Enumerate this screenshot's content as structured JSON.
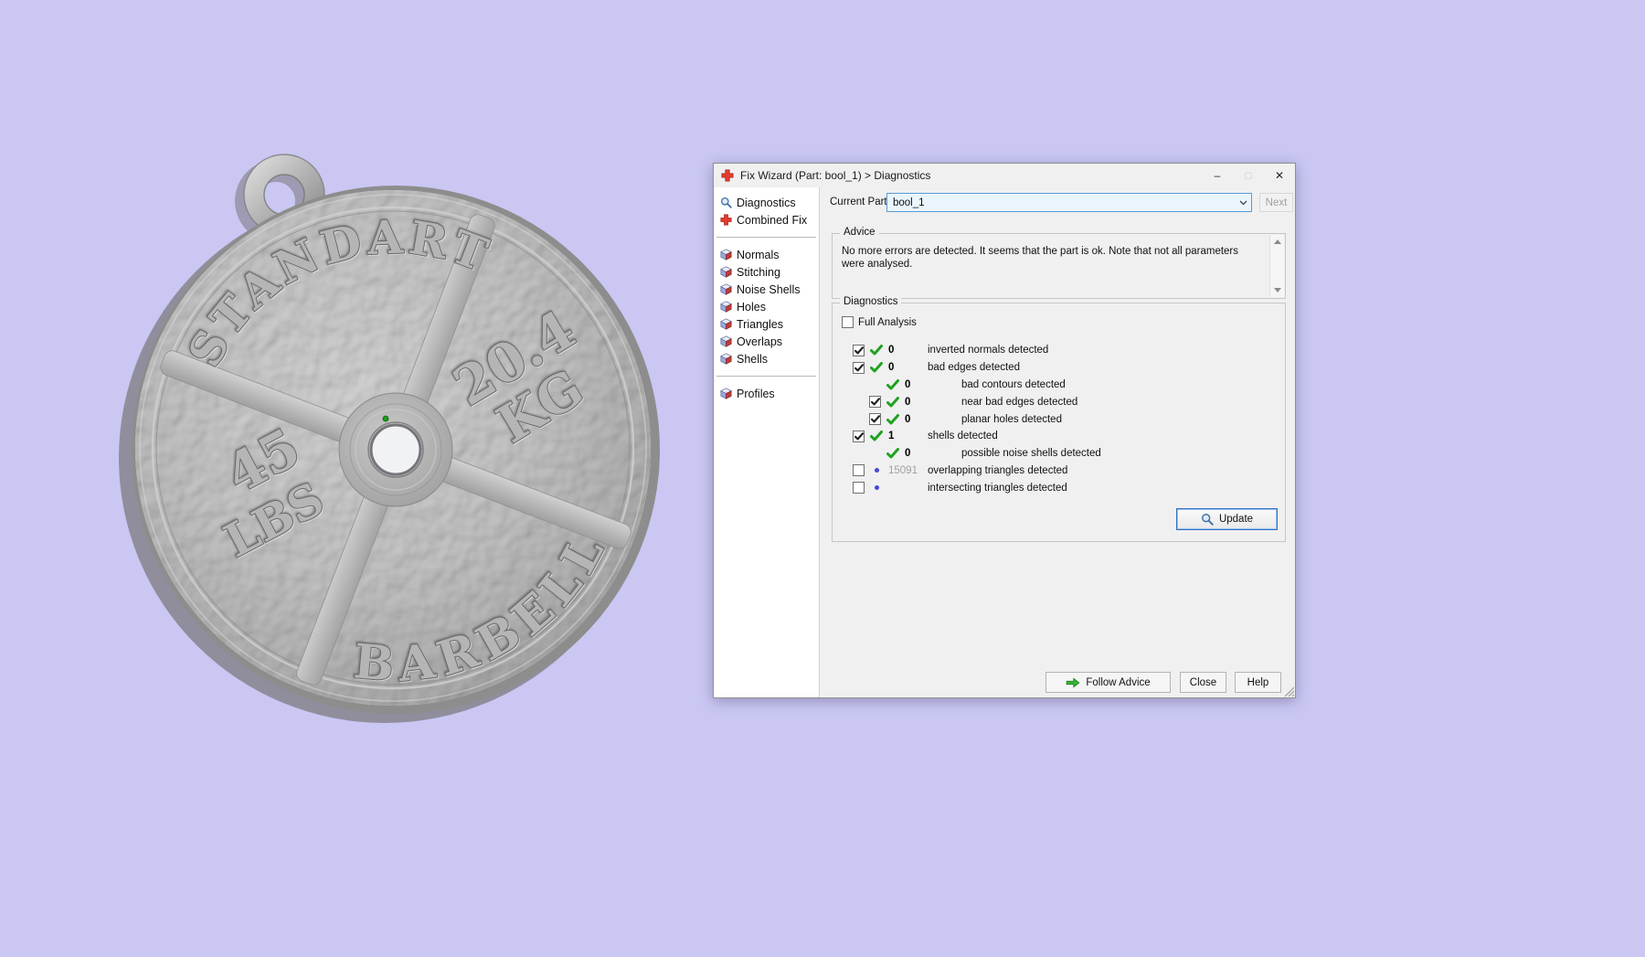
{
  "colors": {
    "page_background": "#cac7f3",
    "check_green": "#1ea21e",
    "marker_blue": "#4646d8",
    "combo_border": "#5a9bd5",
    "update_border": "#2f6fc1",
    "title_icon_red": "#e23b2e"
  },
  "scene": {
    "plate": {
      "arc_top": "STANDART",
      "arc_bottom": "BARBELL",
      "kg_value": "20.4",
      "kg_unit": "KG",
      "lbs_value": "45",
      "lbs_unit": "LBS"
    }
  },
  "window": {
    "title": "Fix Wizard (Part: bool_1) > Diagnostics",
    "controls": {
      "minimize": "–",
      "maximize": "□",
      "close": "✕"
    },
    "sidebar": {
      "items": [
        {
          "label": "Diagnostics"
        },
        {
          "label": "Combined Fix"
        },
        {
          "label": "Normals"
        },
        {
          "label": "Stitching"
        },
        {
          "label": "Noise Shells"
        },
        {
          "label": "Holes"
        },
        {
          "label": "Triangles"
        },
        {
          "label": "Overlaps"
        },
        {
          "label": "Shells"
        },
        {
          "label": "Profiles"
        }
      ]
    },
    "toolbar": {
      "current_part_label": "Current Part:",
      "current_part_value": "bool_1",
      "next_label": "Next"
    },
    "advice": {
      "legend": "Advice",
      "text": "No more errors are detected. It seems that the part is ok. Note that not all parameters were analysed."
    },
    "diagnostics": {
      "legend": "Diagnostics",
      "full_analysis_label": "Full Analysis",
      "update_label": "Update",
      "rows": [
        {
          "checked": true,
          "status": "ok",
          "indent": 0,
          "count": "0",
          "label": "inverted normals detected"
        },
        {
          "checked": true,
          "status": "ok",
          "indent": 0,
          "count": "0",
          "label": "bad edges detected"
        },
        {
          "checked": null,
          "status": "ok",
          "indent": 1,
          "count": "0",
          "label": "bad contours detected"
        },
        {
          "checked": true,
          "status": "ok",
          "indent": 1,
          "count": "0",
          "label": "near bad edges detected"
        },
        {
          "checked": true,
          "status": "ok",
          "indent": 1,
          "count": "0",
          "label": "planar holes detected"
        },
        {
          "checked": true,
          "status": "ok",
          "indent": 0,
          "count": "1",
          "label": "shells detected"
        },
        {
          "checked": null,
          "status": "ok",
          "indent": 1,
          "count": "0",
          "label": "possible noise shells detected"
        },
        {
          "checked": false,
          "status": "info",
          "indent": 0,
          "count": "15091",
          "label": "overlapping triangles detected"
        },
        {
          "checked": false,
          "status": "info",
          "indent": 0,
          "count": "",
          "label": "intersecting triangles detected"
        }
      ]
    },
    "footer": {
      "follow_advice": "Follow Advice",
      "close": "Close",
      "help": "Help"
    }
  }
}
